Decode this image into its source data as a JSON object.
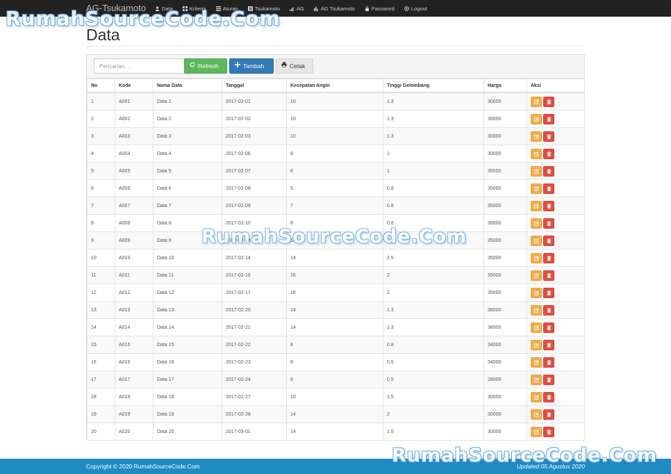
{
  "navbar": {
    "brand": "AG-Tsukamoto",
    "items": [
      {
        "label": "Data",
        "icon": "user-icon"
      },
      {
        "label": "Kriteria",
        "icon": "grid-icon"
      },
      {
        "label": "Aturan",
        "icon": "list-icon"
      },
      {
        "label": "Tsukamoto",
        "icon": "list-alt-icon"
      },
      {
        "label": "AG",
        "icon": "signal-icon"
      },
      {
        "label": "AG Tsukamoto",
        "icon": "stats-icon"
      },
      {
        "label": "Password",
        "icon": "lock-icon"
      },
      {
        "label": "Logout",
        "icon": "logout-icon"
      }
    ]
  },
  "watermark": "RumahSourceCode.Com",
  "page": {
    "title": "Data"
  },
  "toolbar": {
    "search_placeholder": "Pencarian. . .",
    "refresh_label": "Refresh",
    "tambah_label": "Tambah",
    "cetak_label": "Cetak"
  },
  "table": {
    "headers": [
      "No",
      "Kode",
      "Nama Data",
      "Tanggal",
      "Kecepatan Angin",
      "Tinggi Gelombang",
      "Harga",
      "Aksi"
    ],
    "rows": [
      [
        "1",
        "A001",
        "Data 1",
        "2017-02-01",
        "10",
        "1.3",
        "30000"
      ],
      [
        "2",
        "A002",
        "Data 2",
        "2017-02-02",
        "10",
        "1.3",
        "30000"
      ],
      [
        "3",
        "A003",
        "Data 3",
        "2017-02-03",
        "10",
        "1.3",
        "30000"
      ],
      [
        "4",
        "A004",
        "Data 4",
        "2017-02-06",
        "8",
        "1",
        "30000"
      ],
      [
        "5",
        "A005",
        "Data 5",
        "2017-02-07",
        "8",
        "1",
        "35000"
      ],
      [
        "6",
        "A006",
        "Data 6",
        "2017-02-08",
        "5",
        "0.8",
        "35000"
      ],
      [
        "7",
        "A007",
        "Data 7",
        "2017-02-09",
        "7",
        "0.8",
        "35000"
      ],
      [
        "8",
        "A008",
        "Data 8",
        "2017-02-10",
        "8",
        "0.8",
        "35000"
      ],
      [
        "9",
        "A009",
        "Data 9",
        "2017-02-13",
        "14",
        "2.5",
        "35000"
      ],
      [
        "10",
        "A010",
        "Data 10",
        "2017-02-14",
        "14",
        "2.5",
        "35000"
      ],
      [
        "11",
        "A011",
        "Data 11",
        "2017-02-16",
        "16",
        "2",
        "35000"
      ],
      [
        "12",
        "A012",
        "Data 12",
        "2017-02-17",
        "16",
        "2",
        "35000"
      ],
      [
        "13",
        "A013",
        "Data 13",
        "2017-02-20",
        "14",
        "1.3",
        "38000"
      ],
      [
        "14",
        "A014",
        "Data 14",
        "2017-02-21",
        "14",
        "1.3",
        "38000"
      ],
      [
        "15",
        "A015",
        "Data 15",
        "2017-02-22",
        "8",
        "0.8",
        "34000"
      ],
      [
        "16",
        "A016",
        "Data 16",
        "2017-02-23",
        "8",
        "0.5",
        "34000"
      ],
      [
        "17",
        "A017",
        "Data 17",
        "2017-02-24",
        "8",
        "0.5",
        "28000"
      ],
      [
        "18",
        "A018",
        "Data 18",
        "2017-02-27",
        "10",
        "1.5",
        "30000"
      ],
      [
        "19",
        "A019",
        "Data 19",
        "2017-02-28",
        "14",
        "2",
        "30000"
      ],
      [
        "20",
        "A020",
        "Data 20",
        "2017-03-01",
        "14",
        "1.5",
        "30000"
      ]
    ]
  },
  "footer": {
    "copyright": "Copyright © 2020 RumahSourceCode.Com",
    "updated": "Updated 05 Agustus 2020"
  },
  "colors": {
    "navbar": "#222222",
    "refresh": "#5cb85c",
    "tambah": "#337ab7",
    "edit": "#f0ad4e",
    "delete": "#e74c3c",
    "footer": "#1e8bc3"
  }
}
